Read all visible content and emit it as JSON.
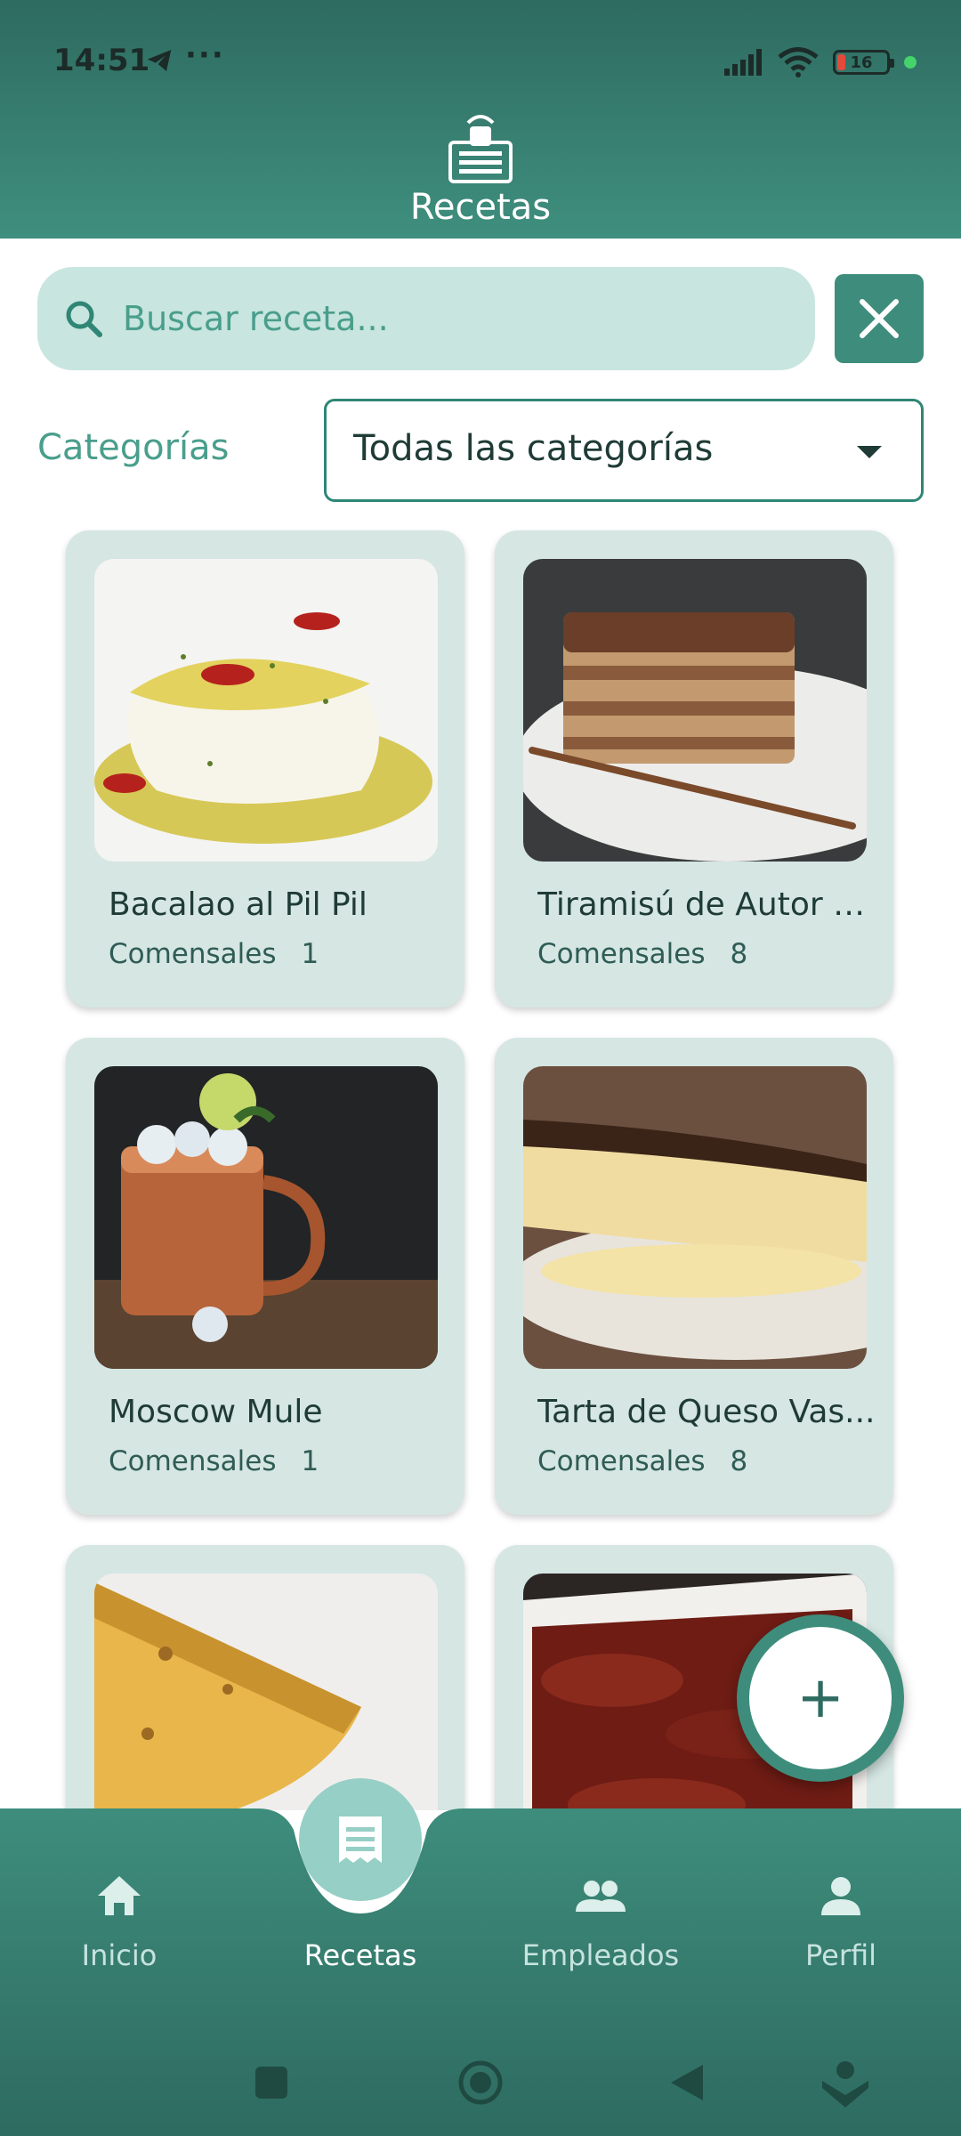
{
  "status_bar": {
    "time": "14:51",
    "dots": "···",
    "battery_level": 16,
    "battery_text": "16"
  },
  "header": {
    "title": "Recetas",
    "icon": "recipe-book-icon"
  },
  "search": {
    "placeholder": "Buscar receta...",
    "value": ""
  },
  "categories": {
    "label": "Categorías",
    "selected": "Todas las categorías"
  },
  "recipes": [
    {
      "name": "Bacalao al Pil Pil",
      "diners_label": "Comensales",
      "diners": "1"
    },
    {
      "name": "Tiramisú de Autor (...",
      "diners_label": "Comensales",
      "diners": "8"
    },
    {
      "name": "Moscow Mule",
      "diners_label": "Comensales",
      "diners": "1"
    },
    {
      "name": "Tarta de Queso Vas...",
      "diners_label": "Comensales",
      "diners": "8"
    },
    {
      "name": "",
      "diners_label": "",
      "diners": ""
    },
    {
      "name": "",
      "diners_label": "",
      "diners": ""
    }
  ],
  "fab": {
    "label": "+"
  },
  "nav": {
    "items": [
      {
        "label": "Inicio",
        "icon": "home-icon"
      },
      {
        "label": "Recetas",
        "icon": "receipt-icon",
        "active": true
      },
      {
        "label": "Empleados",
        "icon": "people-icon"
      },
      {
        "label": "Perfil",
        "icon": "person-icon"
      }
    ]
  },
  "colors": {
    "primary": "#3e8d7c",
    "header_dark": "#2e6b60",
    "card_bg": "#d5e6e3",
    "search_bg": "#c8e5df"
  }
}
